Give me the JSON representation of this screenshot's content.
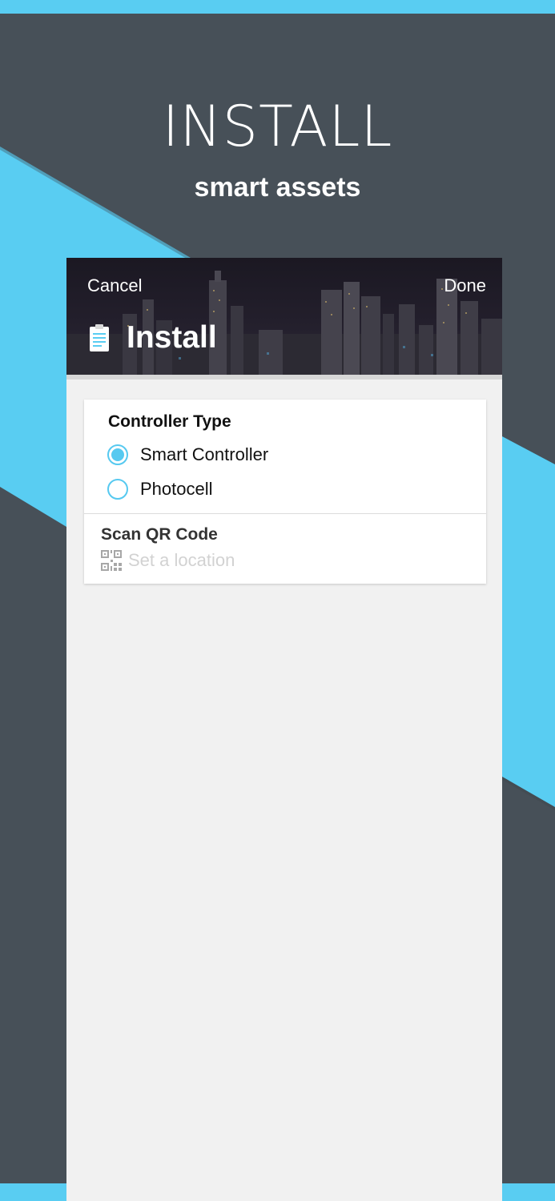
{
  "hero": {
    "title": "INSTALL",
    "subtitle": "smart assets"
  },
  "header": {
    "cancel_label": "Cancel",
    "done_label": "Done",
    "title": "Install",
    "icon": "clipboard-icon"
  },
  "controller_type": {
    "label": "Controller Type",
    "options": [
      {
        "label": "Smart Controller",
        "selected": true
      },
      {
        "label": "Photocell",
        "selected": false
      }
    ]
  },
  "scan": {
    "label": "Scan QR Code",
    "placeholder": "Set a location",
    "icon": "qr-code-icon"
  },
  "colors": {
    "accent": "#59cdf2",
    "background": "#475058",
    "panel": "#f1f1f1"
  }
}
